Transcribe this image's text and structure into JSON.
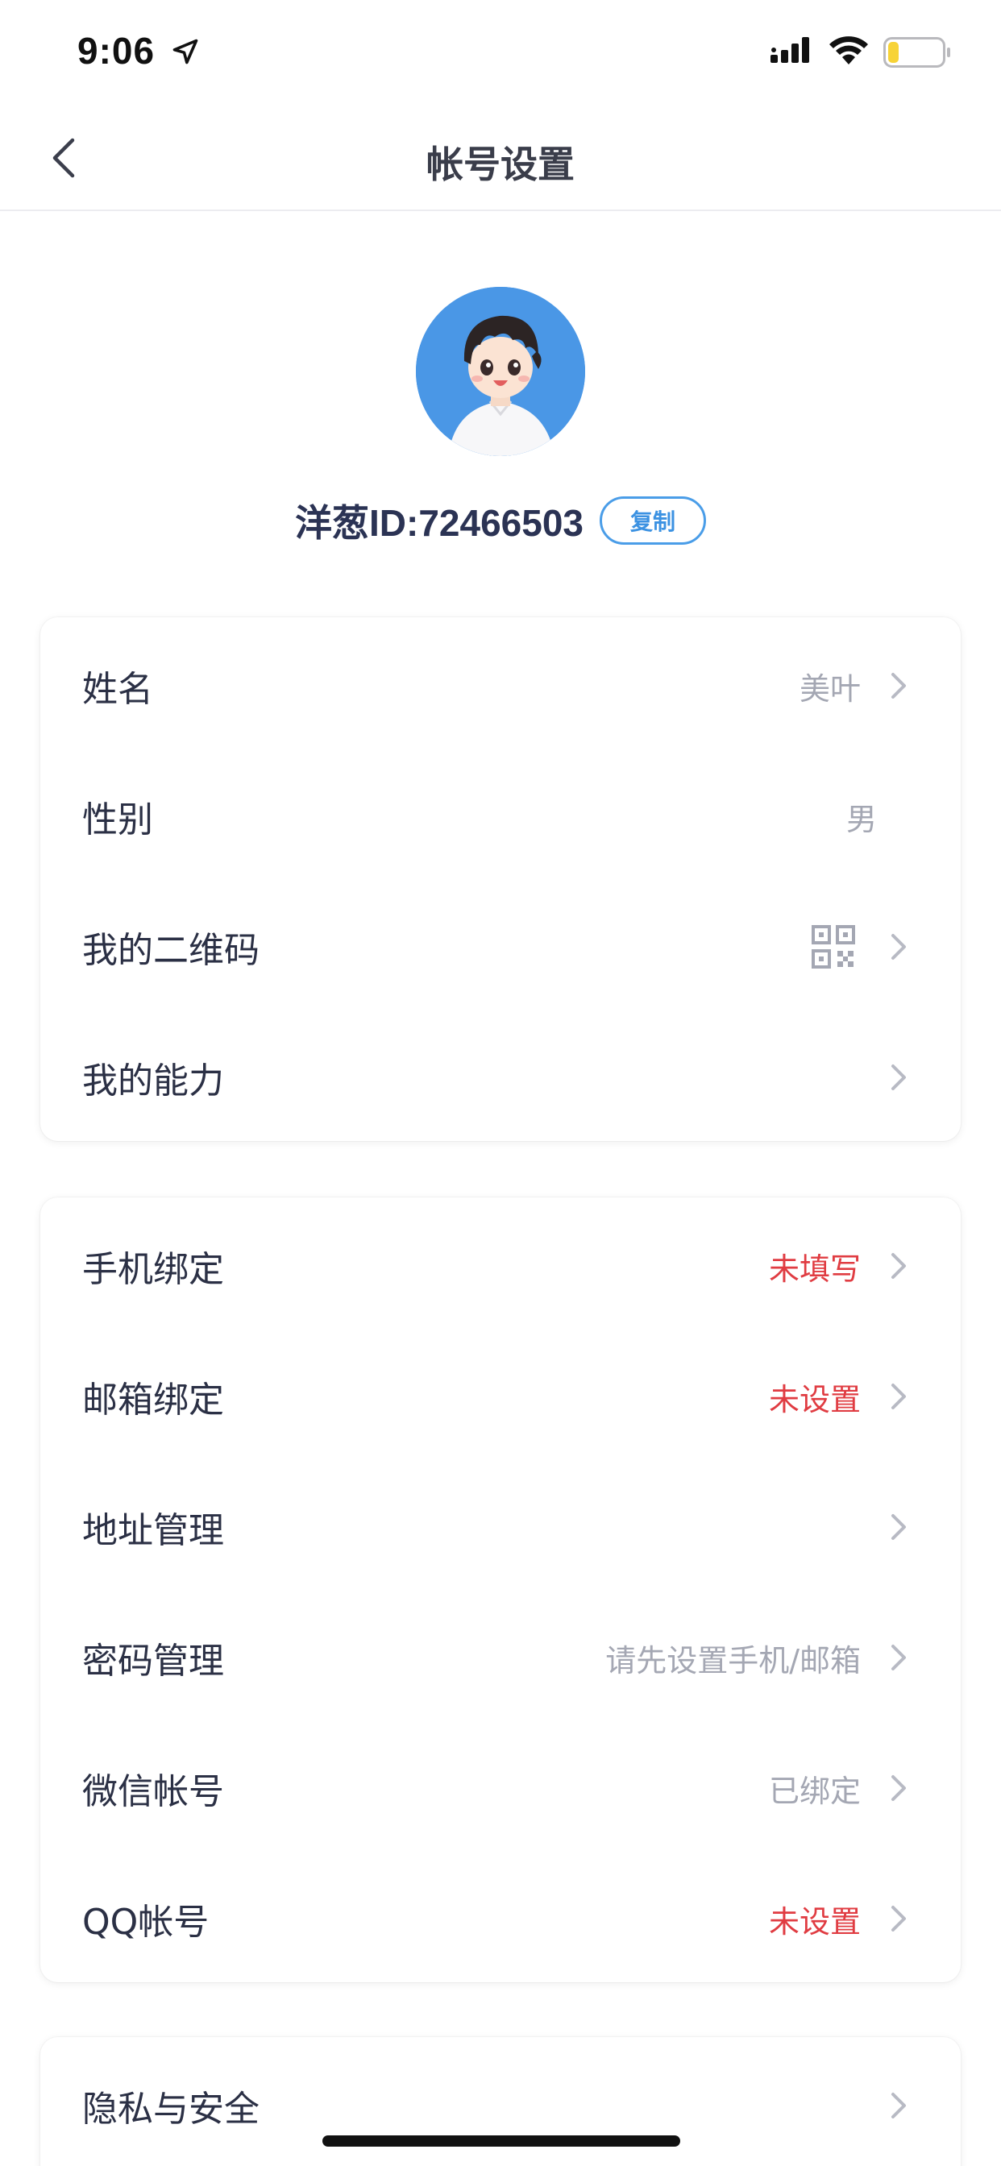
{
  "status_bar": {
    "time": "9:06"
  },
  "nav": {
    "title": "帐号设置"
  },
  "profile": {
    "id_text": "洋葱ID:72466503",
    "copy_label": "复制"
  },
  "group1": [
    {
      "label": "姓名",
      "value": "美叶",
      "value_style": "gray",
      "chevron": true
    },
    {
      "label": "性别",
      "value": "男",
      "value_style": "gray",
      "chevron": false
    },
    {
      "label": "我的二维码",
      "icon": "qr-code-icon",
      "chevron": true
    },
    {
      "label": "我的能力",
      "chevron": true
    }
  ],
  "group2": [
    {
      "label": "手机绑定",
      "value": "未填写",
      "value_style": "red",
      "chevron": true
    },
    {
      "label": "邮箱绑定",
      "value": "未设置",
      "value_style": "red",
      "chevron": true
    },
    {
      "label": "地址管理",
      "chevron": true
    },
    {
      "label": "密码管理",
      "value": "请先设置手机/邮箱",
      "value_style": "gray",
      "chevron": true
    },
    {
      "label": "微信帐号",
      "value": "已绑定",
      "value_style": "gray",
      "chevron": true
    },
    {
      "label": "QQ帐号",
      "value": "未设置",
      "value_style": "red",
      "chevron": true
    }
  ],
  "group3": [
    {
      "label": "隐私与安全",
      "chevron": true
    }
  ],
  "colors": {
    "accent": "#4a9de8",
    "warning_red": "#e03c42",
    "secondary_text": "#a4a7b3",
    "primary_text": "#2b3045",
    "avatar_bg": "#4a97e6"
  },
  "status_bar_battery_level": 0.2
}
